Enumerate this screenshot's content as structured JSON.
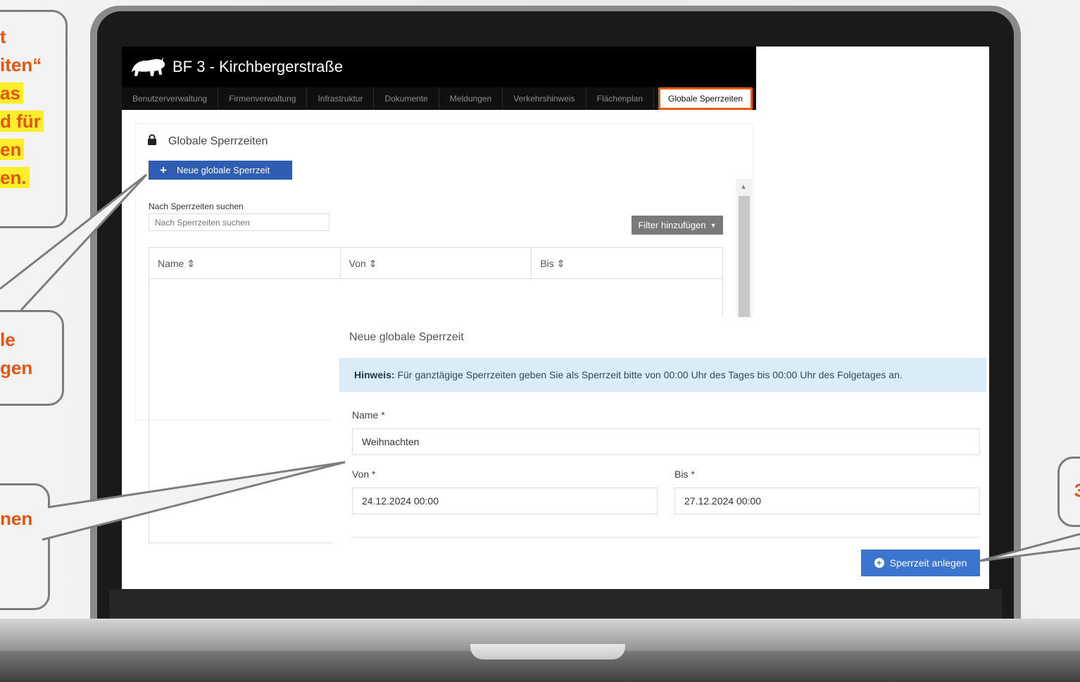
{
  "app": {
    "title": "BF 3 - Kirchbergerstraße",
    "logo": "bison-logo"
  },
  "nav": {
    "items": [
      "Benutzerverwaltung",
      "Firmenverwaltung",
      "Infrastruktur",
      "Dokumente",
      "Meldungen",
      "Verkehrshinweis",
      "Flächenplan"
    ],
    "active_label": "Globale Sperrzeiten"
  },
  "panel": {
    "title": "Globale Sperrzeiten",
    "new_button": "Neue globale Sperrzeit",
    "search_label": "Nach Sperrzeiten suchen",
    "search_placeholder": "Nach Sperrzeiten suchen",
    "filter_button": "Filter hinzufügen",
    "columns": [
      "Name",
      "Von",
      "Bis"
    ]
  },
  "modal": {
    "title": "Neue globale Sperrzeit",
    "hint_bold": "Hinweis:",
    "hint_text": " Für ganztägige Sperrzeiten geben Sie als Sperrzeit bitte von 00:00 Uhr des Tages bis 00:00 Uhr des Folgetages an.",
    "name_label": "Name *",
    "name_value": "Weihnachten",
    "von_label": "Von *",
    "von_value": "24.12.2024 00:00",
    "bis_label": "Bis *",
    "bis_value": "27.12.2024 00:00",
    "submit_label": "Sperrzeit anlegen"
  },
  "callouts": {
    "first": [
      "t",
      "iten“",
      "as",
      "d für",
      "en",
      "en."
    ],
    "second": [
      "le",
      "gen"
    ],
    "third": [
      "nen"
    ],
    "fourth": [
      "3"
    ]
  },
  "colors": {
    "accent": "#ea5b10",
    "callout_text": "#e8530e",
    "highlight": "#ffef2a",
    "primary_button": "#2e5db3",
    "submit_button": "#3c75d0",
    "hint_bg": "#d9ecf7"
  }
}
